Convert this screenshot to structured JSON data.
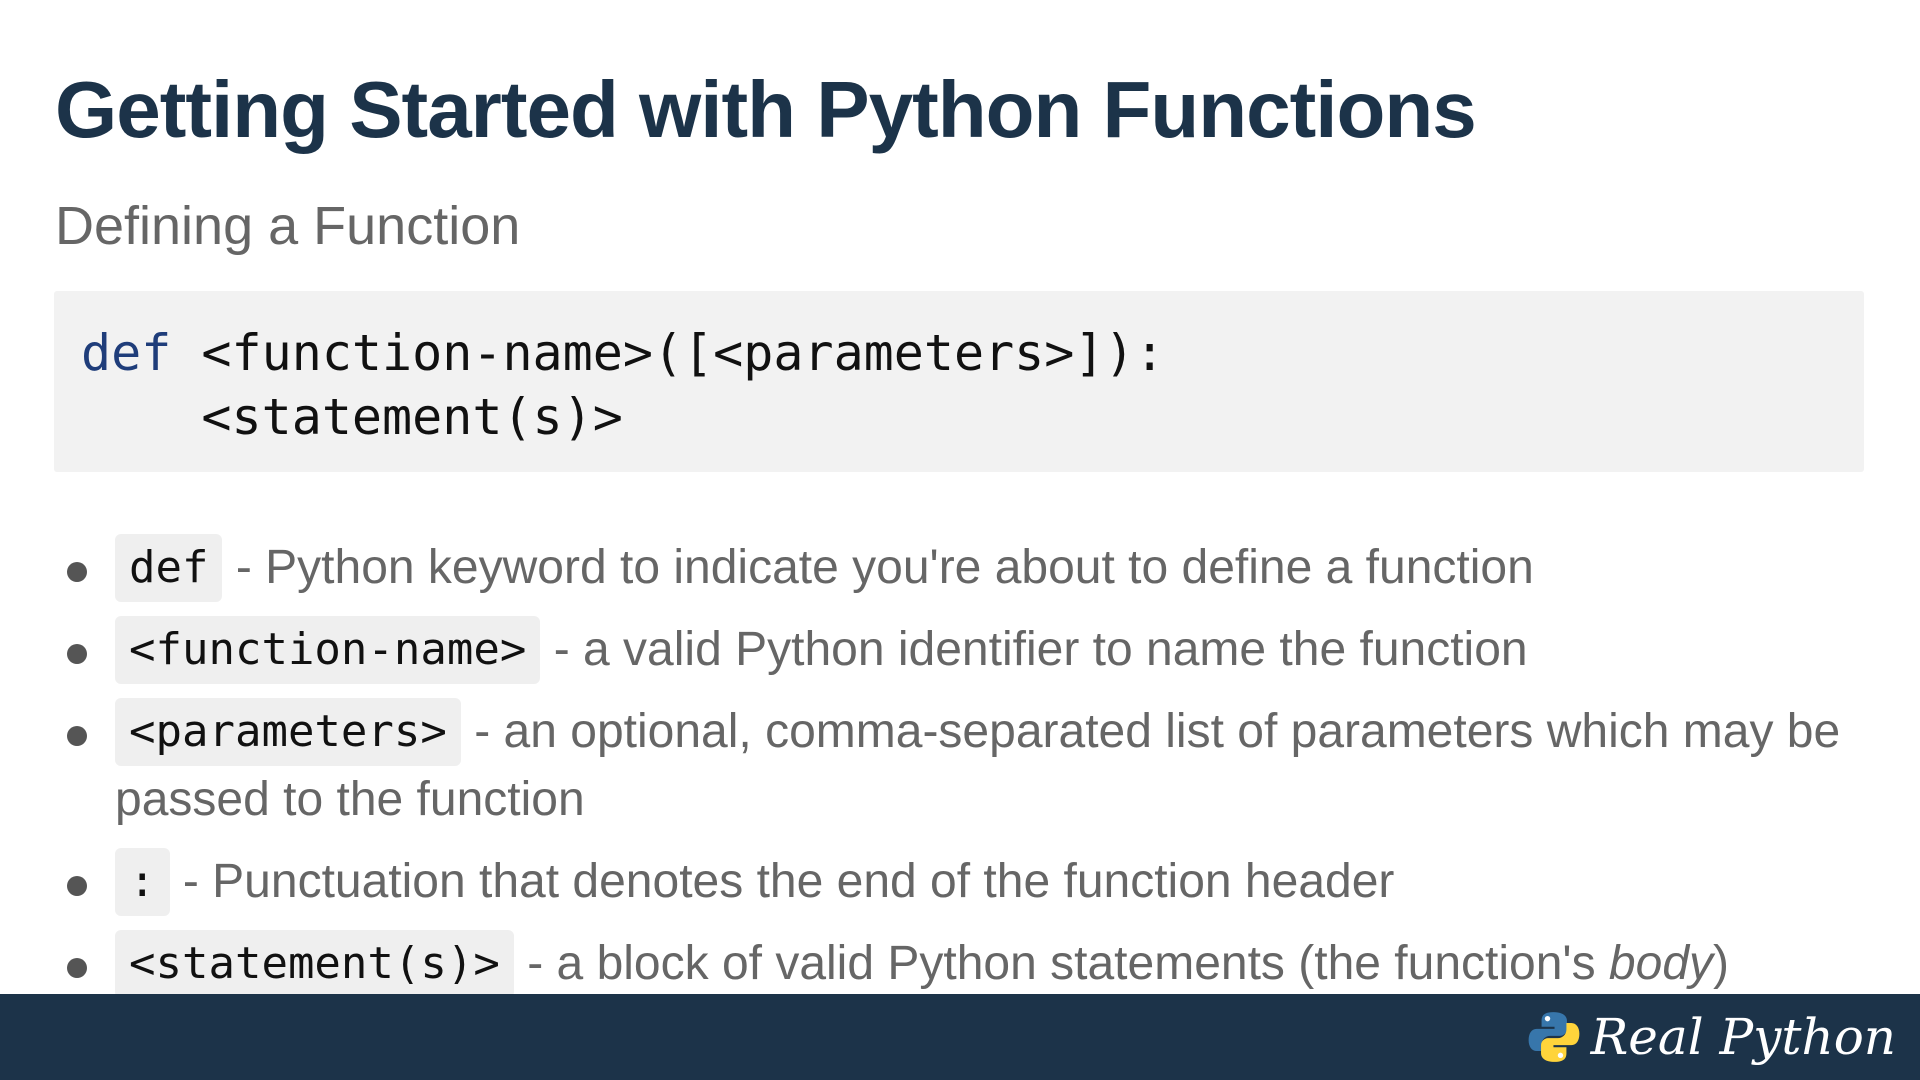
{
  "slide": {
    "title": "Getting Started with Python Functions",
    "subtitle": "Defining a Function"
  },
  "code_block": {
    "keyword": "def",
    "line1_rest": " <function-name>([<parameters>]):",
    "line2": "    <statement(s)>"
  },
  "bullets": [
    {
      "code": "def",
      "text": " - Python keyword to indicate you're about to define a function"
    },
    {
      "code": "<function-name>",
      "text": " - a valid Python identifier to name the function"
    },
    {
      "code": "<parameters>",
      "text": " - an optional, comma-separated list of parameters which may be passed to the function"
    },
    {
      "code": ":",
      "text": " - Punctuation that denotes the end of the function header"
    },
    {
      "code": "<statement(s)>",
      "text": " - a block of valid Python statements (the function's ",
      "emphasis": "body",
      "text_end": ")"
    }
  ],
  "footer": {
    "logo_text": "Real Python",
    "logo_icon": "python-logo-icon",
    "colors": {
      "background": "#1c3349",
      "python_blue": "#3776ab",
      "python_yellow": "#ffd43b"
    }
  }
}
